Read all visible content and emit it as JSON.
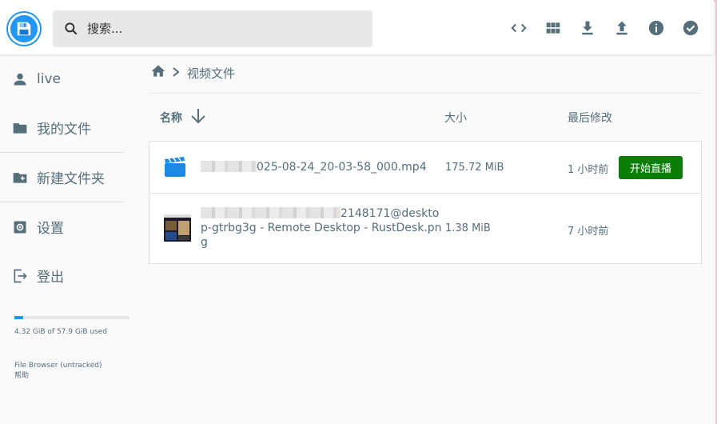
{
  "header": {
    "search_placeholder": "搜索...",
    "actions": [
      "code-icon",
      "grid-view-icon",
      "download-icon",
      "upload-icon",
      "info-icon",
      "check-circle-icon"
    ]
  },
  "sidebar": {
    "items": [
      {
        "label": "live",
        "icon": "person-icon"
      },
      {
        "label": "我的文件",
        "icon": "folder-icon"
      },
      {
        "label": "新建文件夹",
        "icon": "new-folder-icon"
      },
      {
        "label": "设置",
        "icon": "settings-icon"
      },
      {
        "label": "登出",
        "icon": "logout-icon"
      }
    ],
    "storage_text": "4.32 GiB of 57.9 GiB used",
    "storage_fraction": 0.075,
    "footer_line1": "File Browser (untracked)",
    "footer_line2": "帮助"
  },
  "breadcrumbs": {
    "current": "视频文件"
  },
  "list": {
    "columns": {
      "name": "名称",
      "size": "大小",
      "modified": "最后修改"
    },
    "rows": [
      {
        "name_line1": "025-08-24_20-03-58_000.mp4",
        "size": "175.72 MiB",
        "modified": "1 小时前",
        "action": "开始直播"
      },
      {
        "name_line1": "2148171@deskto",
        "name_line2": "p-gtrbg3g - Remote Desktop - RustDesk.pn",
        "name_line3": "g",
        "size": "1.38 MiB",
        "modified": "7 小时前"
      }
    ]
  },
  "colors": {
    "accent": "#2196f3",
    "live_button": "#0a7e07",
    "text": "#546e7a"
  }
}
